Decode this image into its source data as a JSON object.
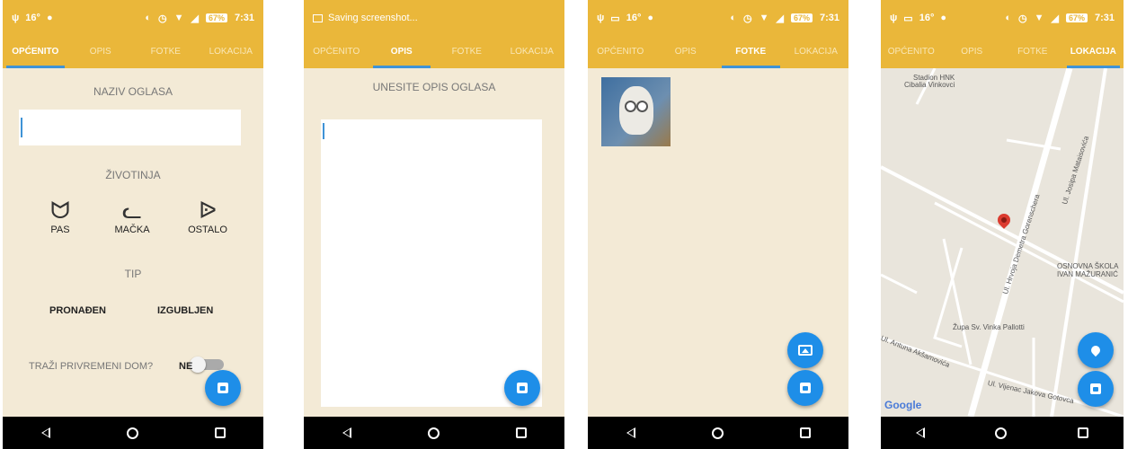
{
  "tabs": [
    "OPĆENITO",
    "OPIS",
    "FOTKE",
    "LOKACIJA"
  ],
  "status": {
    "time": "7:31",
    "temp": "16°",
    "battery": "67%",
    "saving": "Saving screenshot..."
  },
  "general": {
    "name_label": "NAZIV OGLASA",
    "name_value": "",
    "animal_label": "ŽIVOTINJA",
    "animals": [
      "PAS",
      "MAČKA",
      "OSTALO"
    ],
    "type_label": "TIP",
    "types": [
      "PRONAĐEN",
      "IZGUBLJEN"
    ],
    "home_label": "TRAŽI PRIVREMENI DOM?",
    "home_value": "NE"
  },
  "description": {
    "label": "UNESITE OPIS OGLASA",
    "value": ""
  },
  "map": {
    "labels": [
      "Stadion HNK",
      "Cibalia Vinkovci",
      "Ul. Josipa Mataisovića",
      "Ul. Hrvoja Demetra Gorenschera",
      "OSNOVNA ŠKOLA",
      "IVAN MAŽURANIĆ",
      "Župa Sv. Vinka Pallotti",
      "Ul. Antuna Akšamovića",
      "Ul. Vijenac Jakova Gotovca"
    ],
    "attribution": "Google"
  },
  "colors": {
    "header": "#eab73a",
    "accent": "#1e8ee8",
    "background": "#f3ead6"
  }
}
